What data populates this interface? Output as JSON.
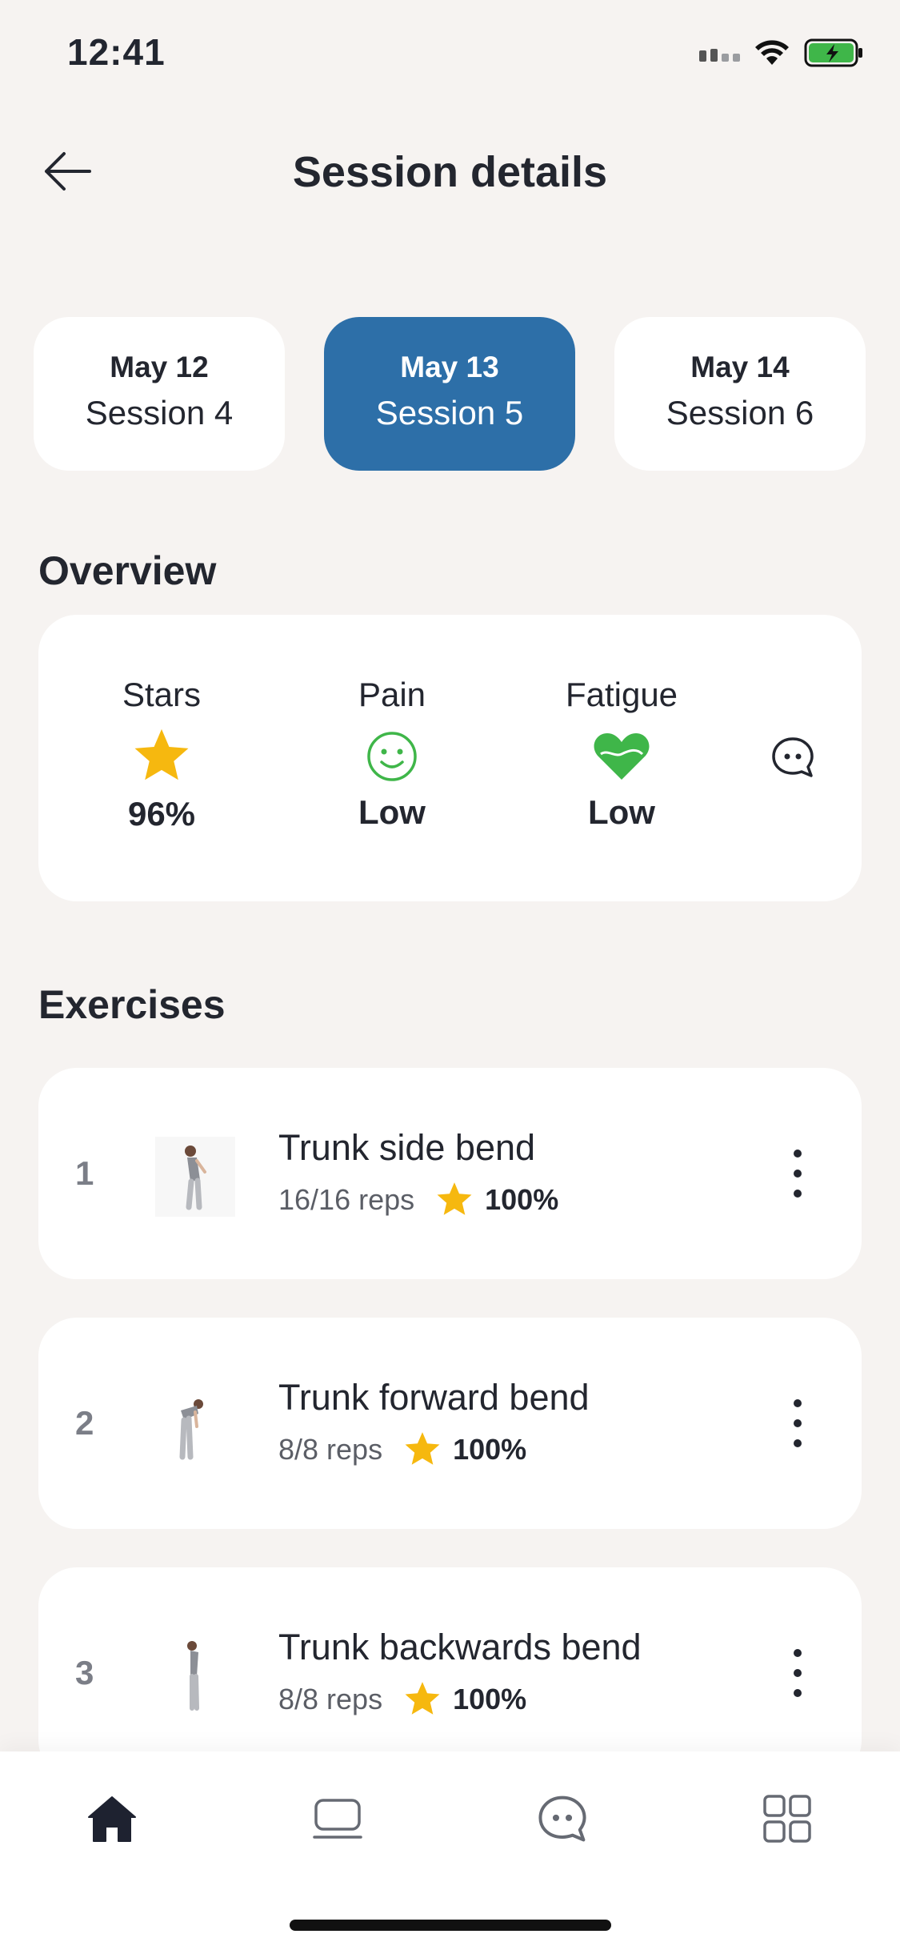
{
  "status_bar": {
    "time": "12:41"
  },
  "header": {
    "title": "Session details"
  },
  "sessions": [
    {
      "date": "May 12",
      "name": "Session 4",
      "active": false
    },
    {
      "date": "May 13",
      "name": "Session 5",
      "active": true
    },
    {
      "date": "May 14",
      "name": "Session 6",
      "active": false
    }
  ],
  "overview": {
    "title": "Overview",
    "stars": {
      "label": "Stars",
      "value": "96%",
      "icon": "star-icon"
    },
    "pain": {
      "label": "Pain",
      "value": "Low",
      "icon": "smiley-icon"
    },
    "fatigue": {
      "label": "Fatigue",
      "value": "Low",
      "icon": "heart-icon"
    },
    "comment_icon": "chat-icon"
  },
  "exercises": {
    "title": "Exercises",
    "items": [
      {
        "number": "1",
        "title": "Trunk side bend",
        "reps": "16/16 reps",
        "score": "100%"
      },
      {
        "number": "2",
        "title": "Trunk forward bend",
        "reps": "8/8 reps",
        "score": "100%"
      },
      {
        "number": "3",
        "title": "Trunk backwards bend",
        "reps": "8/8 reps",
        "score": "100%"
      }
    ]
  },
  "bottom_nav": [
    {
      "name": "home",
      "icon": "home-icon",
      "active": true
    },
    {
      "name": "sessions",
      "icon": "laptop-icon",
      "active": false
    },
    {
      "name": "messages",
      "icon": "chat-icon",
      "active": false
    },
    {
      "name": "more",
      "icon": "grid-icon",
      "active": false
    }
  ],
  "colors": {
    "background": "#f6f3f1",
    "accent": "#2d6fa8",
    "star": "#f6b80f",
    "positive": "#3fb649",
    "text": "#23262f"
  }
}
